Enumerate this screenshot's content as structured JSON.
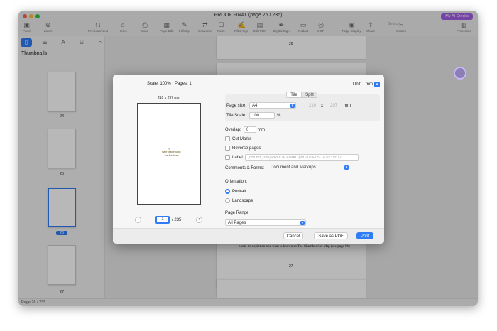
{
  "window": {
    "title": "PROOF FINAL (page 26 / 235)",
    "ai_credits": "My AI Credits",
    "status": "Page 26 / 235",
    "zoom": "100%"
  },
  "toolbar": [
    {
      "icon": "panel-icon",
      "label": "Panel"
    },
    {
      "icon": "zoom-icon",
      "label": "Zoom"
    },
    {
      "icon": "previous-next-icon",
      "label": "Previous/Next"
    },
    {
      "icon": "home-icon",
      "label": "Home"
    },
    {
      "icon": "scan-icon",
      "label": "Scan"
    },
    {
      "icon": "page-edit-icon",
      "label": "Page Edit"
    },
    {
      "icon": "fill-icon",
      "label": "Fill/Sign"
    },
    {
      "icon": "converter-icon",
      "label": "Converter"
    },
    {
      "icon": "form-icon",
      "label": "Form"
    },
    {
      "icon": "fill-sign-icon",
      "label": "Fill & Sign"
    },
    {
      "icon": "edit-pdf-icon",
      "label": "Edit PDF"
    },
    {
      "icon": "digital-sign-icon",
      "label": "Digital Sign"
    },
    {
      "icon": "redact-icon",
      "label": "Redact"
    },
    {
      "icon": "ocr-icon",
      "label": "OCR"
    },
    {
      "icon": "page-display-icon",
      "label": "Page Display"
    },
    {
      "icon": "share-icon",
      "label": "Share"
    },
    {
      "icon": "search-icon",
      "label": "Search"
    },
    {
      "icon": "properties-icon",
      "label": "Properties"
    }
  ],
  "search": {
    "placeholder": "Search"
  },
  "sidebar": {
    "title": "Thumbnails",
    "thumbs": [
      {
        "label": "24"
      },
      {
        "label": "25"
      },
      {
        "label": "26"
      },
      {
        "label": "27"
      }
    ]
  },
  "document": {
    "page_num_top": "26",
    "page_text": "book. Its depiction one what is known as The Chamber Act Map (see page 96)",
    "page_num_bottom": "27"
  },
  "dialog": {
    "scale": "Scale: 100%",
    "pages": "Pages: 1",
    "paper_size": "210 x 297 mm",
    "preview_text": [
      "by",
      "Nate Maple Staw",
      "Joe Nachben"
    ],
    "page_input": "1",
    "page_total": "/ 235",
    "unit_label": "Unit:",
    "unit_value": "mm",
    "tab_tile": "Tile",
    "tab_split": "Split",
    "page_size_label": "Page size:",
    "page_size_value": "A4",
    "width": "210",
    "x": "x",
    "height": "297",
    "dim_unit": "mm",
    "tile_scale_label": "Tile Scale:",
    "tile_scale_value": "100",
    "pct": "%",
    "overlap_label": "Overlap:",
    "overlap_value": "0",
    "overlap_unit": "mm",
    "cut_marks": "Cut Marks",
    "reverse_pages": "Reverse pages",
    "label": "Label",
    "label_placeholder": "(column,row) PROOF FINAL.pdf 2024-05-14 02:08:12",
    "comments_label": "Comments & Forms:",
    "comments_value": "Document and Markups",
    "orientation_label": "Orientation:",
    "portrait": "Portrait",
    "landscape": "Landscape",
    "page_range_label": "Page Range",
    "page_range_value": "All Pages",
    "cancel": "Cancel",
    "save_as_pdf": "Save as PDF",
    "print": "Print"
  }
}
